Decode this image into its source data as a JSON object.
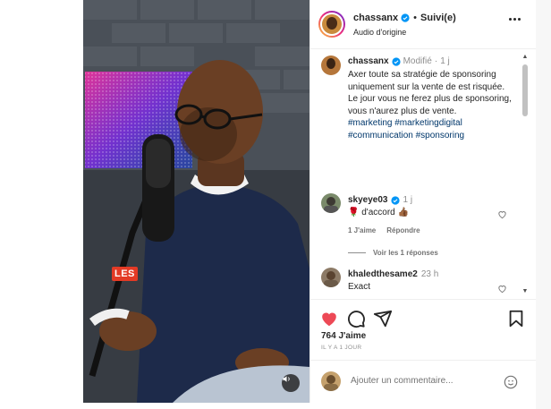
{
  "post": {
    "username": "chassanx",
    "follow_status": "Suivi(e)",
    "dot": "•",
    "audio": "Audio d'origine",
    "media_overlay_text": "LES"
  },
  "caption": {
    "username": "chassanx",
    "edited": "Modifié",
    "dot": "·",
    "time": "1 j",
    "text_line1": "Axer toute sa stratégie de sponsoring uniquement sur la vente de est risquée.",
    "text_line2": "Le jour vous ne ferez plus de sponsoring, vous n'aurez plus de vente.",
    "hashtags": "#marketing #marketingdigital #communication #sponsoring"
  },
  "comments": [
    {
      "username": "skyeye03",
      "time": "1 j",
      "text": "🌹 d'accord 👍🏾",
      "like_label": "1 J'aime",
      "reply_label": "Répondre",
      "view_replies": "Voir les 1 réponses"
    },
    {
      "username": "khaledthesame2",
      "time": "23 h",
      "text": "Exact"
    }
  ],
  "actions": {
    "likes": "764 J'aime",
    "date": "IL Y A 1 JOUR"
  },
  "add_comment": {
    "placeholder": "Ajouter un commentaire..."
  },
  "icons": {
    "more": "more-horizontal-icon",
    "verified": "verified-badge-icon",
    "like": "heart-icon",
    "comment": "comment-icon",
    "share": "paper-plane-icon",
    "save": "bookmark-icon",
    "emoji": "smiley-icon",
    "mute": "speaker-icon"
  },
  "colors": {
    "liked_heart": "#ed4956",
    "verified": "#0095f6",
    "hashtag": "#00376b",
    "overlay_badge": "#e33a25"
  }
}
